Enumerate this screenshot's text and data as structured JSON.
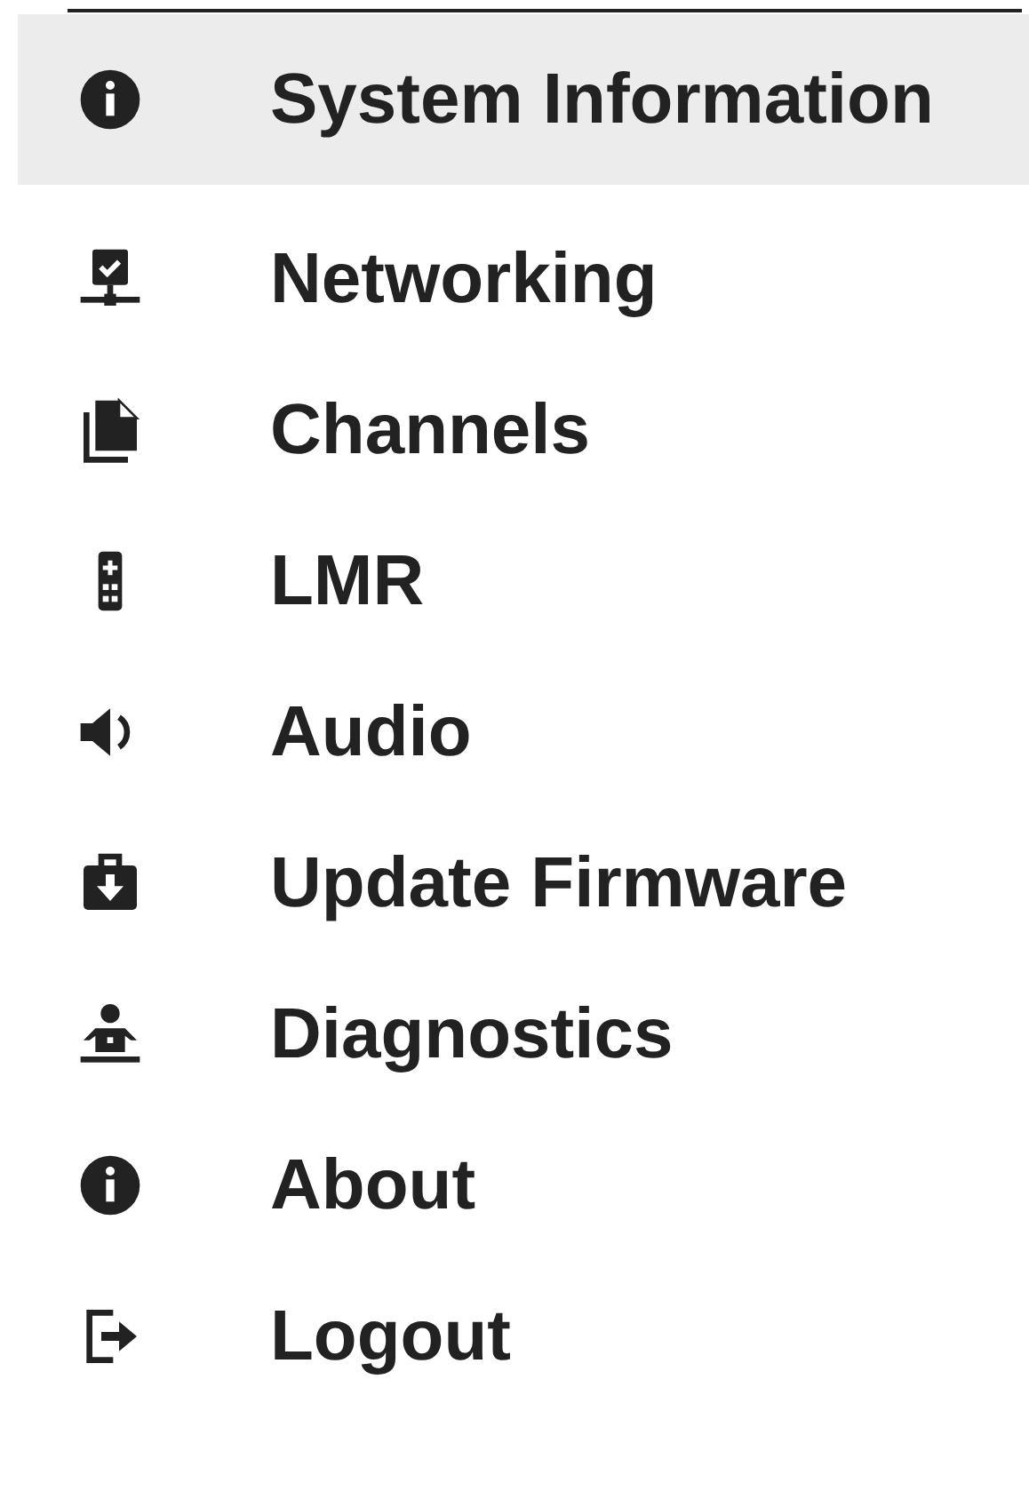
{
  "menu": [
    {
      "label": "System Information",
      "kind": "info",
      "selected": true
    },
    {
      "label": "Networking",
      "kind": "network",
      "selected": false
    },
    {
      "label": "Channels",
      "kind": "files",
      "selected": false
    },
    {
      "label": "LMR",
      "kind": "remote",
      "selected": false
    },
    {
      "label": "Audio",
      "kind": "speaker",
      "selected": false
    },
    {
      "label": "Update Firmware",
      "kind": "briefcase",
      "selected": false
    },
    {
      "label": "Diagnostics",
      "kind": "person",
      "selected": false
    },
    {
      "label": "About",
      "kind": "info",
      "selected": false
    },
    {
      "label": "Logout",
      "kind": "logout",
      "selected": false
    }
  ]
}
